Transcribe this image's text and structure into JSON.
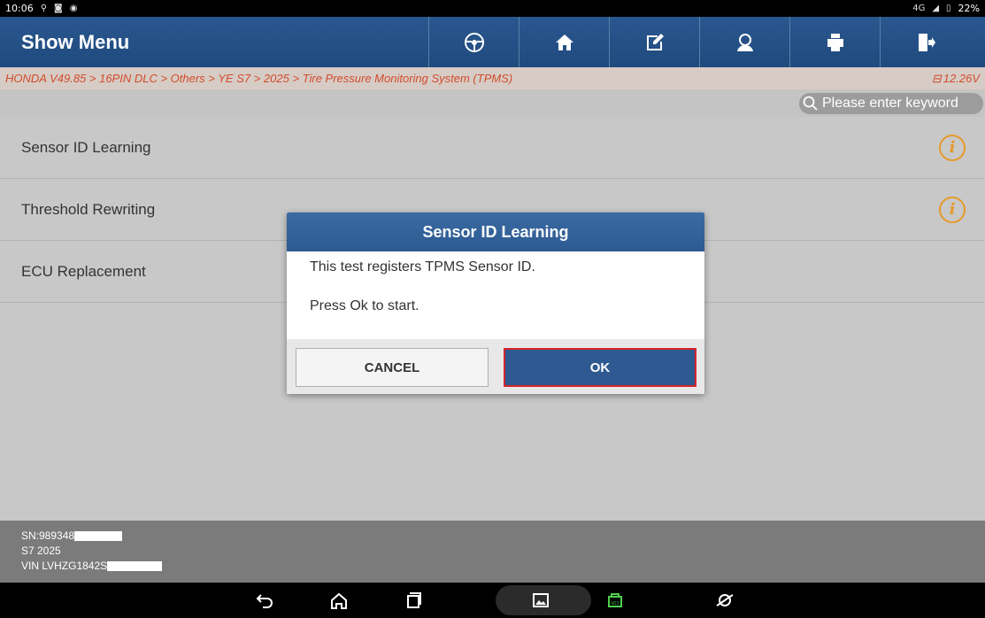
{
  "status_bar": {
    "time": "10:06",
    "network": "4G",
    "battery": "22%"
  },
  "header": {
    "title": "Show Menu",
    "buttons": [
      "steering-wheel-icon",
      "home-icon",
      "edit-icon",
      "user-icon",
      "printer-icon",
      "exit-icon"
    ]
  },
  "breadcrumb": {
    "path": "HONDA V49.85 > 16PIN DLC > Others > YE S7 > 2025 > Tire Pressure Monitoring System (TPMS)",
    "voltage": "12.26V"
  },
  "search": {
    "placeholder": "Please enter keyword"
  },
  "menu_items": [
    {
      "label": "Sensor ID Learning",
      "has_info": true
    },
    {
      "label": "Threshold Rewriting",
      "has_info": true
    },
    {
      "label": "ECU Replacement",
      "has_info": false
    }
  ],
  "footer": {
    "sn_prefix": "SN:989348",
    "model": "S7 2025",
    "vin_prefix": "VIN LVHZG1842S"
  },
  "dialog": {
    "title": "Sensor ID Learning",
    "line1": "This test registers TPMS Sensor ID.",
    "line2": "Press Ok to start.",
    "cancel_label": "CANCEL",
    "ok_label": "OK"
  },
  "colors": {
    "header": "#2a578f",
    "breadcrumb_text": "#d24b2c",
    "info": "#e69a2a",
    "ok_border": "#d8262c"
  }
}
